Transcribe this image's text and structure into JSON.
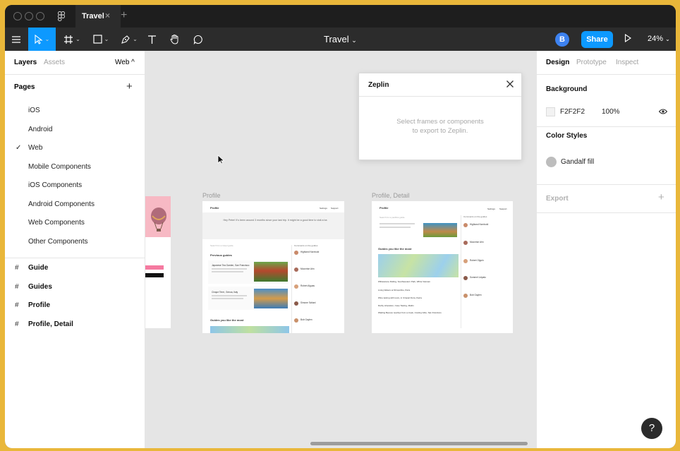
{
  "window": {
    "tab_title": "Travel",
    "tab_close": "×",
    "new_tab": "+"
  },
  "toolbar": {
    "file_name": "Travel",
    "file_chevron": "⌄",
    "avatar_initial": "B",
    "share_label": "Share",
    "zoom_label": "24%",
    "zoom_chevron": "⌄"
  },
  "left_panel": {
    "tabs": {
      "layers": "Layers",
      "assets": "Assets",
      "page_selector": "Web ^"
    },
    "pages_header": "Pages",
    "pages": [
      "iOS",
      "Android",
      "Web",
      "Mobile Components",
      "iOS Components",
      "Android Components",
      "Web Components",
      "Other Components"
    ],
    "current_page": "Web",
    "check_mark": "✓",
    "layers": [
      "Guide",
      "Guides",
      "Profile",
      "Profile, Detail"
    ]
  },
  "canvas": {
    "frames": [
      {
        "label": "Profile"
      },
      {
        "label": "Profile, Detail"
      }
    ],
    "zeplin": {
      "title": "Zeplin",
      "message_line1": "Select frames or components",
      "message_line2": "to export to Zeplin."
    }
  },
  "mini_profile": {
    "header": "Profile",
    "nav": [
      "Settings",
      "Support"
    ],
    "banner_text": "Hey Peter! It's been around 3 months since your last trip. It might be a good time to visit a ba",
    "search_placeholder": "Search for a travel guide",
    "previous_guides": "Previous guides",
    "guide1": "Japanese Tea Garden, San Francisco",
    "guide2": "Cinque Terre, Genoa, Italy",
    "guides_like": "Guides you like the most",
    "comments_header": "Comments on the guides",
    "people": [
      "Highland Nordvold",
      "Moonrise Ahn",
      "Robert Alguas",
      "Simone Szilard",
      "Bob Gaylen"
    ]
  },
  "mini_detail": {
    "header": "Profile",
    "nav": [
      "Settings",
      "Support"
    ],
    "search_placeholder": "Search for a pacifica guide",
    "guides_like": "Guides you like the most",
    "comments_header": "Comments on the guides",
    "rows": [
      "Willowstone Rolling, Southwestern Park, White Vietnam",
      "Living Waters at Shropshire, Paris",
      "Wine tasting with tours, in Crispari Dora, Iberia",
      "Darby Liberation, Cave Tasting, Matlin",
      "Wading Beeves nearbys from a creek, Costing Gibe, San Francisco"
    ],
    "people": [
      "Highland Nordvold",
      "Moonrise Ahn",
      "Robert Olguin",
      "Sommel Lidpalo",
      "Bob Gaylen"
    ]
  },
  "right_panel": {
    "tabs": {
      "design": "Design",
      "prototype": "Prototype",
      "inspect": "Inspect"
    },
    "background_title": "Background",
    "background_hex": "F2F2F2",
    "background_opacity": "100%",
    "color_styles_title": "Color Styles",
    "color_style_name": "Gandalf fill",
    "export_title": "Export",
    "export_plus": "+"
  },
  "help_label": "?",
  "colors": {
    "accent": "#0d99ff",
    "outer_frame": "#e9b73a",
    "toolbar": "#2c2c2c",
    "canvas": "#e5e5e5"
  }
}
